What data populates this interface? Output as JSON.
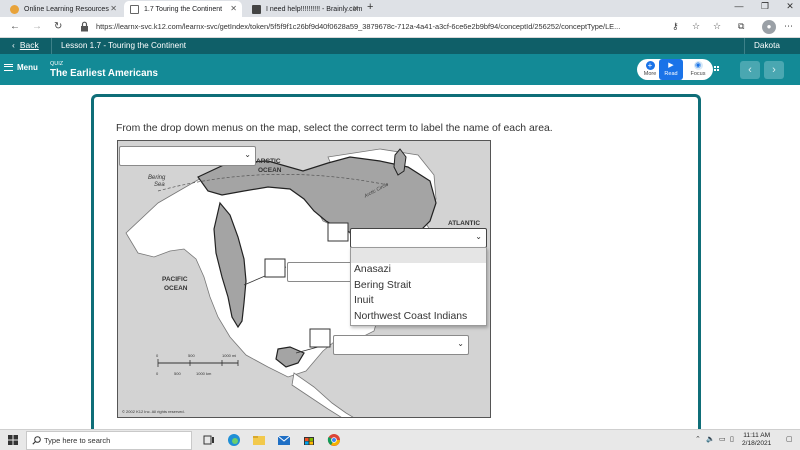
{
  "browser": {
    "tabs": [
      {
        "title": "Online Learning Resources",
        "active": false,
        "favicon_color": "#e8a33a"
      },
      {
        "title": "1.7 Touring the Continent",
        "active": true,
        "favicon_color": "#1b6e78"
      },
      {
        "title": "I need help!!!!!!!!!! - Brainly.com",
        "active": false,
        "favicon_color": "#3a5ee8"
      }
    ],
    "new_tab_icon": "plus-icon",
    "url": "https://learnx-svc.k12.com/learnx-svc/getIndex/token/5f5f9f1c26bf9d40f0628a59_3879678c-712a-4a41-a3cf-6ce6e2b9bf94/conceptId/256252/conceptType/LE..."
  },
  "k12": {
    "back_label": "Back",
    "lesson_title": "Lesson 1.7 - Touring the Continent",
    "student_name": "Dakota",
    "menu_label": "Menu",
    "quiz_tag": "QUIZ",
    "quiz_title": "The Earliest Americans",
    "tools": [
      {
        "label": "More",
        "icon": "plus-icon"
      },
      {
        "label": "Read",
        "icon": "play-icon"
      },
      {
        "label": "Focus",
        "icon": "eye-icon"
      }
    ]
  },
  "question": {
    "prompt": "From the drop down menus on the map, select the correct term to label the name of each area.",
    "map_labels": {
      "arctic": "ARCTIC",
      "arctic2": "OCEAN",
      "bering": "Bering",
      "bering2": "Sea",
      "atlantic": "ATLANTIC",
      "pacific": "PACIFIC",
      "pacific2": "OCEAN",
      "arctic_circle": "Arctic Circle",
      "scale_mi_0": "0",
      "scale_mi_500": "500",
      "scale_mi_1000": "1000 mi",
      "scale_km_0": "0",
      "scale_km_500": "500",
      "scale_km_1000": "1000 km",
      "copyright": "© 2002 K12 Inc. All rights reserved."
    },
    "dropdown_options": [
      "Anasazi",
      "Bering Strait",
      "Inuit",
      "Northwest Coast Indians"
    ],
    "dropdown_values": [
      "",
      "",
      "",
      ""
    ]
  },
  "taskbar": {
    "search_placeholder": "Type here to search",
    "time": "11:11 AM",
    "date": "2/18/2021"
  }
}
